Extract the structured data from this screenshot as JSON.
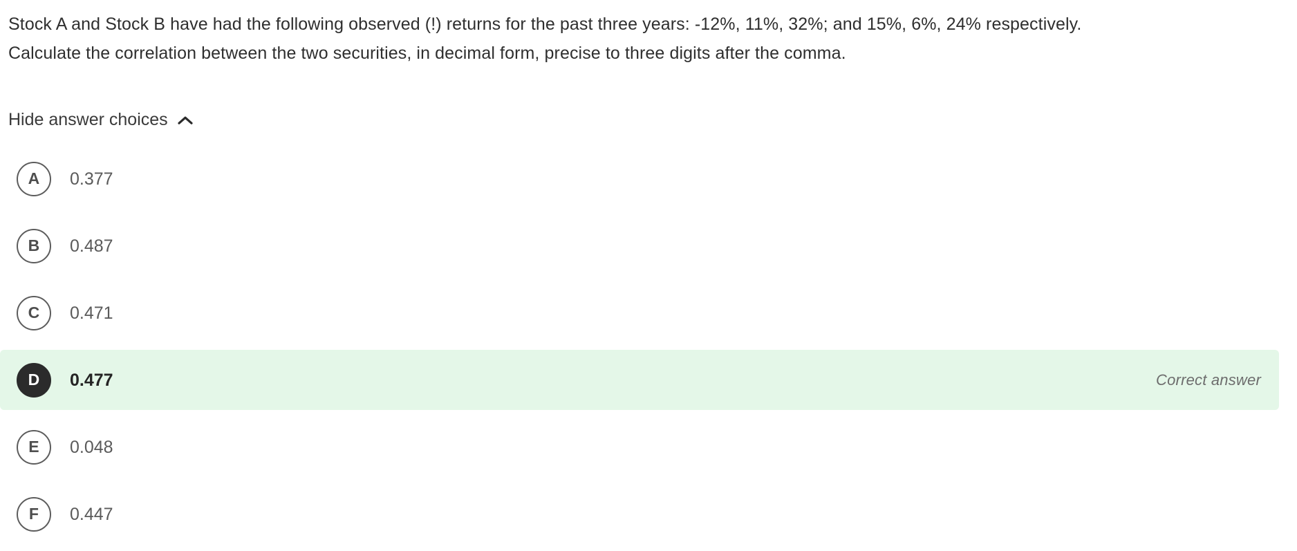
{
  "question": {
    "line1": "Stock A and Stock B have had the following observed (!) returns for the past three years: -12%, 11%, 32%; and 15%, 6%, 24% respectively.",
    "line2": "Calculate the correlation between the two securities, in decimal form, precise to three digits after the comma."
  },
  "toggle": {
    "label": "Hide answer choices",
    "icon": "chevron-up-icon"
  },
  "choices": [
    {
      "letter": "A",
      "text": "0.377",
      "correct": false,
      "flag": ""
    },
    {
      "letter": "B",
      "text": "0.487",
      "correct": false,
      "flag": ""
    },
    {
      "letter": "C",
      "text": "0.471",
      "correct": false,
      "flag": ""
    },
    {
      "letter": "D",
      "text": "0.477",
      "correct": true,
      "flag": "Correct answer"
    },
    {
      "letter": "E",
      "text": "0.048",
      "correct": false,
      "flag": ""
    },
    {
      "letter": "F",
      "text": "0.447",
      "correct": false,
      "flag": ""
    }
  ],
  "colors": {
    "correct_row_background": "#e4f7e8",
    "correct_marker_background": "#2b2b2b",
    "body_text": "#2f2f2f",
    "choice_text": "#5a5a5a",
    "marker_border": "#5c5c5c"
  }
}
